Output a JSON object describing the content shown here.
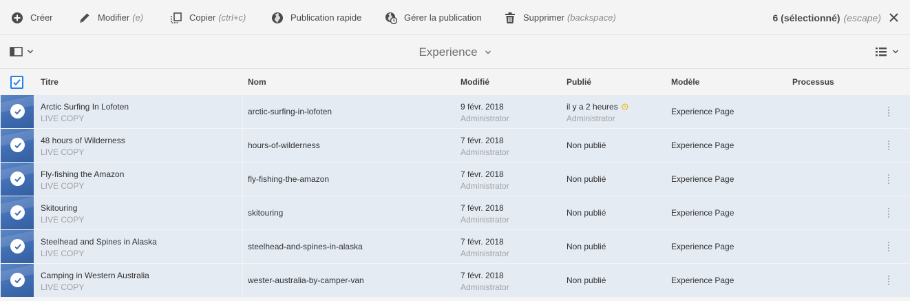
{
  "actionbar": {
    "create_label": "Créer",
    "edit_label": "Modifier",
    "edit_shortcut": "(e)",
    "copy_label": "Copier",
    "copy_shortcut": "(ctrl+c)",
    "quick_publish_label": "Publication rapide",
    "manage_publication_label": "Gérer la publication",
    "delete_label": "Supprimer",
    "delete_shortcut": "(backspace)",
    "selection_count": "6 (sélectionné)",
    "selection_shortcut": "(escape)"
  },
  "secondary_bar": {
    "title": "Experience"
  },
  "table": {
    "headers": {
      "title": "Titre",
      "name": "Nom",
      "modified": "Modifié",
      "published": "Publié",
      "template": "Modèle",
      "workflow": "Processus"
    },
    "rows": [
      {
        "title": "Arctic Surfing In Lofoten",
        "subtitle": "LIVE COPY",
        "name": "arctic-surfing-in-lofoten",
        "modified_date": "9 févr. 2018",
        "modified_by": "Administrator",
        "published": "il y a 2 heures",
        "published_by": "Administrator",
        "template": "Experience Page",
        "selected": true
      },
      {
        "title": "48 hours of Wilderness",
        "subtitle": "LIVE COPY",
        "name": "hours-of-wilderness",
        "modified_date": "7 févr. 2018",
        "modified_by": "Administrator",
        "published": "Non publié",
        "published_by": "",
        "template": "Experience Page",
        "selected": true
      },
      {
        "title": "Fly-fishing the Amazon",
        "subtitle": "LIVE COPY",
        "name": "fly-fishing-the-amazon",
        "modified_date": "7 févr. 2018",
        "modified_by": "Administrator",
        "published": "Non publié",
        "published_by": "",
        "template": "Experience Page",
        "selected": true
      },
      {
        "title": "Skitouring",
        "subtitle": "LIVE COPY",
        "name": "skitouring",
        "modified_date": "7 févr. 2018",
        "modified_by": "Administrator",
        "published": "Non publié",
        "published_by": "",
        "template": "Experience Page",
        "selected": true
      },
      {
        "title": "Steelhead and Spines in Alaska",
        "subtitle": "LIVE COPY",
        "name": "steelhead-and-spines-in-alaska",
        "modified_date": "7 févr. 2018",
        "modified_by": "Administrator",
        "published": "Non publié",
        "published_by": "",
        "template": "Experience Page",
        "selected": true
      },
      {
        "title": "Camping in Western Australia",
        "subtitle": "LIVE COPY",
        "name": "wester-australia-by-camper-van",
        "modified_date": "7 févr. 2018",
        "modified_by": "Administrator",
        "published": "Non publié",
        "published_by": "",
        "template": "Experience Page",
        "selected": true
      }
    ]
  },
  "colors": {
    "accent": "#2680eb",
    "row_selected_bg": "#e5ebf3",
    "thumbnail": "#3f6db3",
    "pending_icon": "#f0b400"
  },
  "icons": {
    "create": "add-circle-icon",
    "edit": "pencil-icon",
    "copy": "copy-icon",
    "quick_publish": "globe-icon",
    "manage_publication": "globe-clock-icon",
    "delete": "trash-icon",
    "close": "close-icon",
    "rail": "rail-panel-icon",
    "view": "list-view-icon",
    "more": "more-vertical-icon",
    "pending": "clock-pending-icon"
  }
}
